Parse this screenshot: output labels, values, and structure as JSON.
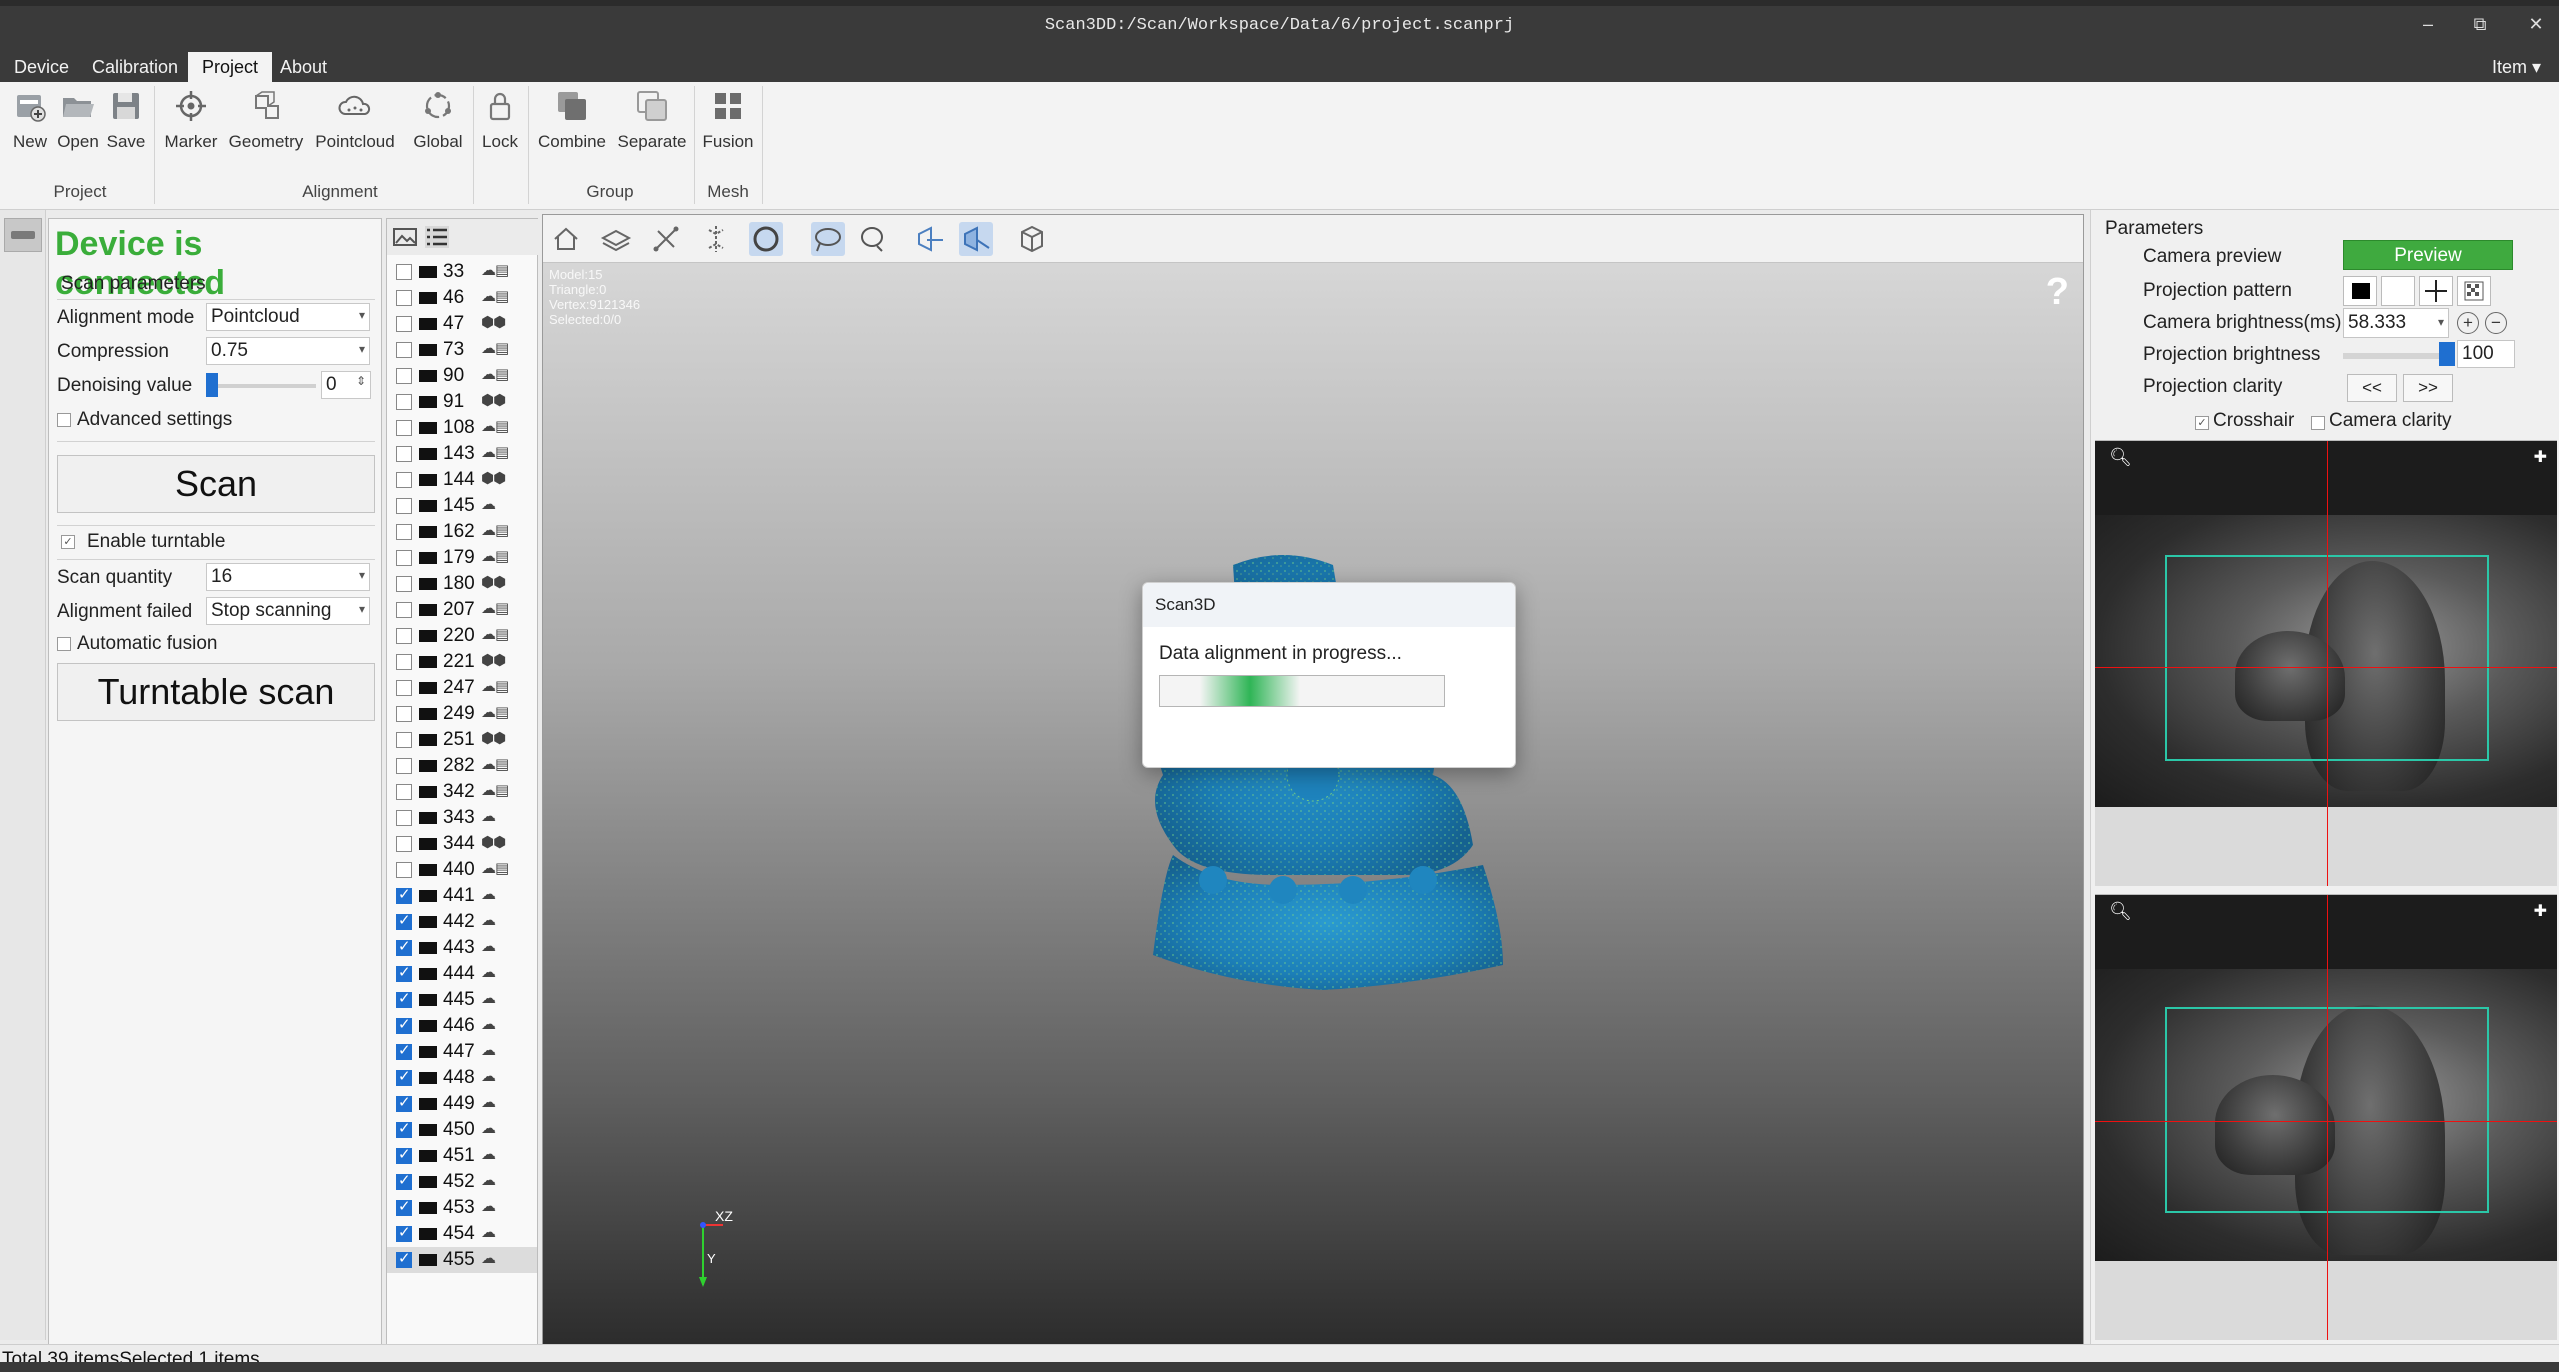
{
  "window": {
    "title": "Scan3DD:/Scan/Workspace/Data/6/project.scanprj",
    "controls": [
      "–",
      "⧉",
      "✕"
    ]
  },
  "menu": {
    "items": [
      "Device",
      "Calibration",
      "Project",
      "About"
    ],
    "active": "Project",
    "right_item": "Item ▾"
  },
  "ribbon": {
    "buttons": [
      {
        "label": "New",
        "icon": "new-project-icon"
      },
      {
        "label": "Open",
        "icon": "open-folder-icon"
      },
      {
        "label": "Save",
        "icon": "save-icon"
      },
      {
        "label": "Marker",
        "icon": "marker-icon"
      },
      {
        "label": "Geometry",
        "icon": "geometry-icon"
      },
      {
        "label": "Pointcloud",
        "icon": "pointcloud-icon"
      },
      {
        "label": "Global",
        "icon": "global-icon"
      },
      {
        "label": "Lock",
        "icon": "lock-icon"
      },
      {
        "label": "Combine",
        "icon": "combine-icon"
      },
      {
        "label": "Separate",
        "icon": "separate-icon"
      },
      {
        "label": "Fusion",
        "icon": "fusion-icon"
      }
    ],
    "groups": [
      "Project",
      "Alignment",
      "Group",
      "Mesh"
    ]
  },
  "device_panel": {
    "status": "Device is connected",
    "status_color": "#3aad3a",
    "scan_params_title": "Scan parameters",
    "alignment_mode_label": "Alignment mode",
    "alignment_mode_value": "Pointcloud",
    "compression_label": "Compression",
    "compression_value": "0.75",
    "denoising_label": "Denoising value",
    "denoising_value": "0",
    "advanced_settings_label": "Advanced settings",
    "scan_button": "Scan",
    "enable_turntable_label": "Enable turntable",
    "scan_quantity_label": "Scan quantity",
    "scan_quantity_value": "16",
    "alignment_failed_label": "Alignment failed",
    "alignment_failed_value": "Stop scanning",
    "automatic_fusion_label": "Automatic fusion",
    "turntable_scan_button": "Turntable scan"
  },
  "scan_list": {
    "items": [
      {
        "id": "33",
        "checked": false,
        "icons": "☁▤"
      },
      {
        "id": "46",
        "checked": false,
        "icons": "☁▤"
      },
      {
        "id": "47",
        "checked": false,
        "icons": "⬢⬢"
      },
      {
        "id": "73",
        "checked": false,
        "icons": "☁▤"
      },
      {
        "id": "90",
        "checked": false,
        "icons": "☁▤"
      },
      {
        "id": "91",
        "checked": false,
        "icons": "⬢⬢"
      },
      {
        "id": "108",
        "checked": false,
        "icons": "☁▤"
      },
      {
        "id": "143",
        "checked": false,
        "icons": "☁▤"
      },
      {
        "id": "144",
        "checked": false,
        "icons": "⬢⬢"
      },
      {
        "id": "145",
        "checked": false,
        "icons": "☁"
      },
      {
        "id": "162",
        "checked": false,
        "icons": "☁▤"
      },
      {
        "id": "179",
        "checked": false,
        "icons": "☁▤"
      },
      {
        "id": "180",
        "checked": false,
        "icons": "⬢⬢"
      },
      {
        "id": "207",
        "checked": false,
        "icons": "☁▤"
      },
      {
        "id": "220",
        "checked": false,
        "icons": "☁▤"
      },
      {
        "id": "221",
        "checked": false,
        "icons": "⬢⬢"
      },
      {
        "id": "247",
        "checked": false,
        "icons": "☁▤"
      },
      {
        "id": "249",
        "checked": false,
        "icons": "☁▤"
      },
      {
        "id": "251",
        "checked": false,
        "icons": "⬢⬢"
      },
      {
        "id": "282",
        "checked": false,
        "icons": "☁▤"
      },
      {
        "id": "342",
        "checked": false,
        "icons": "☁▤"
      },
      {
        "id": "343",
        "checked": false,
        "icons": "☁"
      },
      {
        "id": "344",
        "checked": false,
        "icons": "⬢⬢"
      },
      {
        "id": "440",
        "checked": false,
        "icons": "☁▤"
      },
      {
        "id": "441",
        "checked": true,
        "icons": "☁"
      },
      {
        "id": "442",
        "checked": true,
        "icons": "☁"
      },
      {
        "id": "443",
        "checked": true,
        "icons": "☁"
      },
      {
        "id": "444",
        "checked": true,
        "icons": "☁"
      },
      {
        "id": "445",
        "checked": true,
        "icons": "☁"
      },
      {
        "id": "446",
        "checked": true,
        "icons": "☁"
      },
      {
        "id": "447",
        "checked": true,
        "icons": "☁"
      },
      {
        "id": "448",
        "checked": true,
        "icons": "☁"
      },
      {
        "id": "449",
        "checked": true,
        "icons": "☁"
      },
      {
        "id": "450",
        "checked": true,
        "icons": "☁"
      },
      {
        "id": "451",
        "checked": true,
        "icons": "☁"
      },
      {
        "id": "452",
        "checked": true,
        "icons": "☁"
      },
      {
        "id": "453",
        "checked": true,
        "icons": "☁"
      },
      {
        "id": "454",
        "checked": true,
        "icons": "☁"
      },
      {
        "id": "455",
        "checked": true,
        "icons": "☁",
        "selected": true
      }
    ]
  },
  "viewport": {
    "stats": [
      "Model:15",
      "Triangle:0",
      "Vertex:9121346",
      "Selected:0/0"
    ],
    "help": "?",
    "axis_xz": "XZ",
    "axis_y": "Y"
  },
  "dialog": {
    "title": "Scan3D",
    "message": "Data alignment in progress...",
    "progress_color": "#2fb556"
  },
  "right_panel": {
    "title": "Parameters",
    "camera_preview_label": "Camera preview",
    "preview_button": "Preview",
    "projection_pattern_label": "Projection pattern",
    "camera_brightness_label": "Camera brightness(ms)",
    "camera_brightness_value": "58.333",
    "projection_brightness_label": "Projection brightness",
    "projection_brightness_value": "100",
    "projection_clarity_label": "Projection clarity",
    "clarity_prev": "<<",
    "clarity_next": ">>",
    "crosshair_label": "Crosshair",
    "camera_clarity_label": "Camera clarity"
  },
  "status_bar": {
    "text": "Total 39 itemsSelected 1 items"
  }
}
